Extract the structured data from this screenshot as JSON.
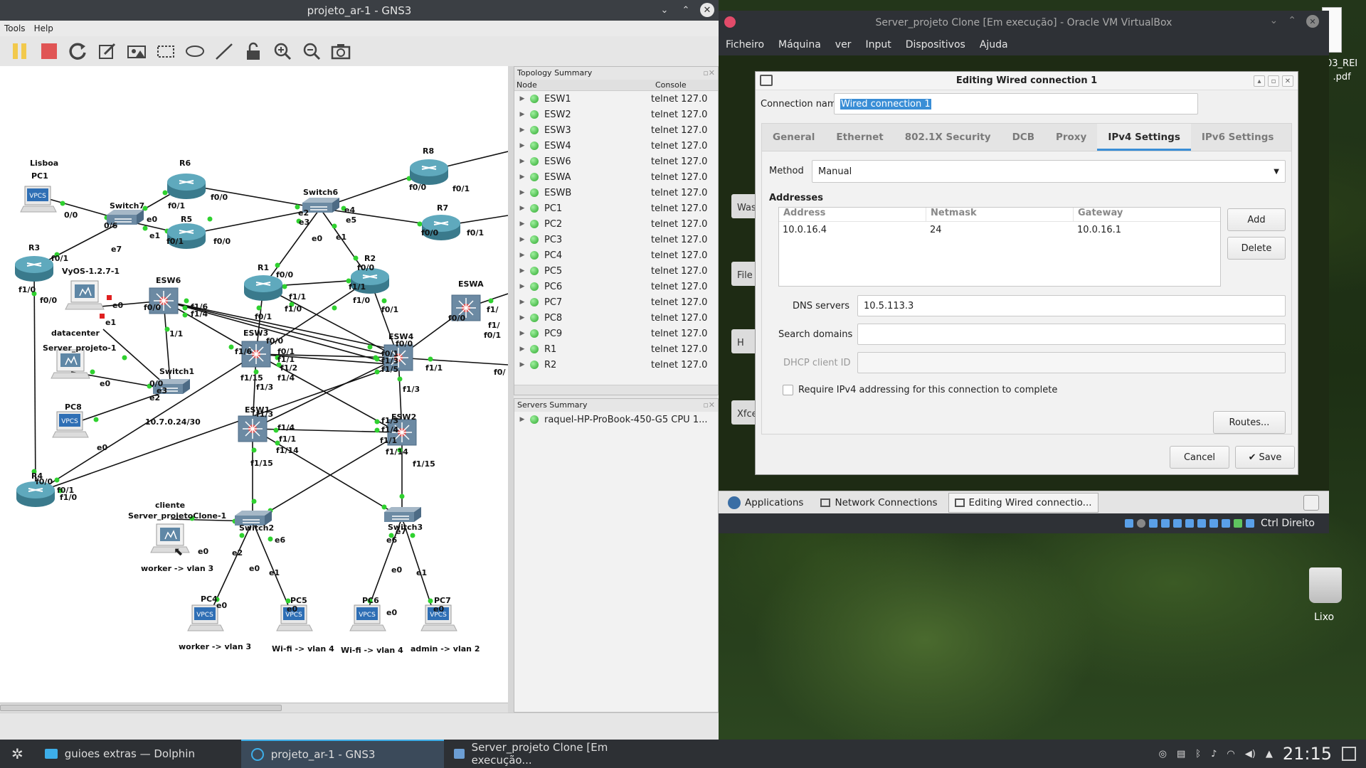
{
  "gns3": {
    "title": "projeto_ar-1 - GNS3",
    "menu": [
      "Tools",
      "Help"
    ],
    "topology_summary": {
      "title": "Topology Summary",
      "col_node": "Node",
      "col_console": "Console",
      "nodes": [
        {
          "name": "ESW1",
          "console": "telnet 127.0"
        },
        {
          "name": "ESW2",
          "console": "telnet 127.0"
        },
        {
          "name": "ESW3",
          "console": "telnet 127.0"
        },
        {
          "name": "ESW4",
          "console": "telnet 127.0"
        },
        {
          "name": "ESW6",
          "console": "telnet 127.0"
        },
        {
          "name": "ESWA",
          "console": "telnet 127.0"
        },
        {
          "name": "ESWB",
          "console": "telnet 127.0"
        },
        {
          "name": "PC1",
          "console": "telnet 127.0"
        },
        {
          "name": "PC2",
          "console": "telnet 127.0"
        },
        {
          "name": "PC3",
          "console": "telnet 127.0"
        },
        {
          "name": "PC4",
          "console": "telnet 127.0"
        },
        {
          "name": "PC5",
          "console": "telnet 127.0"
        },
        {
          "name": "PC6",
          "console": "telnet 127.0"
        },
        {
          "name": "PC7",
          "console": "telnet 127.0"
        },
        {
          "name": "PC8",
          "console": "telnet 127.0"
        },
        {
          "name": "PC9",
          "console": "telnet 127.0"
        },
        {
          "name": "R1",
          "console": "telnet 127.0"
        },
        {
          "name": "R2",
          "console": "telnet 127.0"
        }
      ]
    },
    "servers_summary": {
      "title": "Servers Summary",
      "server": "raquel-HP-ProBook-450-G5 CPU 1..."
    },
    "topology_labels": {
      "lisboa": "Lisboa",
      "pc1": "PC1",
      "r6": "R6",
      "r8": "R8",
      "switch6": "Switch6",
      "switch7": "Switch7",
      "r5": "R5",
      "r7": "R7",
      "r3": "R3",
      "vyos": "VyOS-1.2.7-1",
      "esw6": "ESW6",
      "r1": "R1",
      "r2": "R2",
      "eswa": "ESWA",
      "datacenter": "datacenter",
      "server1": "Server_projeto-1",
      "esw3": "ESW3",
      "esw4": "ESW4",
      "switch1": "Switch1",
      "pc8": "PC8",
      "subnet": "10.7.0.24/30",
      "esw1": "ESW1",
      "esw2": "ESW2",
      "r4": "R4",
      "cliente": "cliente",
      "serverclone": "Server_projetoClone-1",
      "switch2": "Switch2",
      "switch3": "Switch3",
      "worker3": "worker -> vlan 3",
      "pc4": "PC4",
      "pc5": "PC5",
      "pc6": "PC6",
      "pc7": "PC7",
      "worker3b": "worker -> vlan 3",
      "wifi4a": "Wi-fi -> vlan 4",
      "wifi4b": "Wi-fi -> vlan 4",
      "admin2": "admin -> vlan 2",
      "vpcs": "VPCS"
    }
  },
  "vbox": {
    "title": "Server_projeto Clone [Em execução] - Oracle VM VirtualBox",
    "menu": [
      "Ficheiro",
      "Máquina",
      "ver",
      "Input",
      "Dispositivos",
      "Ajuda"
    ],
    "status_host_key": "Ctrl Direito"
  },
  "desktop": {
    "pdf_label": "03_REI\n.pdf",
    "trash_label": "Lixo",
    "guest_icons": [
      "Was",
      "File",
      "H",
      "Xfce"
    ]
  },
  "dialog": {
    "title": "Editing Wired connection 1",
    "conn_name_label": "Connection name",
    "conn_name": "Wired connection 1",
    "tabs": [
      "General",
      "Ethernet",
      "802.1X Security",
      "DCB",
      "Proxy",
      "IPv4 Settings",
      "IPv6 Settings"
    ],
    "method_label": "Method",
    "method": "Manual",
    "addresses_label": "Addresses",
    "addr_cols": [
      "Address",
      "Netmask",
      "Gateway"
    ],
    "addr_row": {
      "address": "10.0.16.4",
      "netmask": "24",
      "gateway": "10.0.16.1"
    },
    "add": "Add",
    "delete": "Delete",
    "dns_label": "DNS servers",
    "dns": "10.5.113.3",
    "search_label": "Search domains",
    "dhcp_label": "DHCP client ID",
    "require_label": "Require IPv4 addressing for this connection to complete",
    "routes": "Routes...",
    "cancel": "Cancel",
    "save": "Save"
  },
  "guest_taskbar": {
    "applications": "Applications",
    "network": "Network Connections",
    "editing": "Editing Wired connectio..."
  },
  "taskbar": {
    "tasks": [
      "guioes extras — Dolphin",
      "projeto_ar-1 - GNS3",
      "Server_projeto Clone [Em execução..."
    ],
    "clock": "21:15"
  }
}
